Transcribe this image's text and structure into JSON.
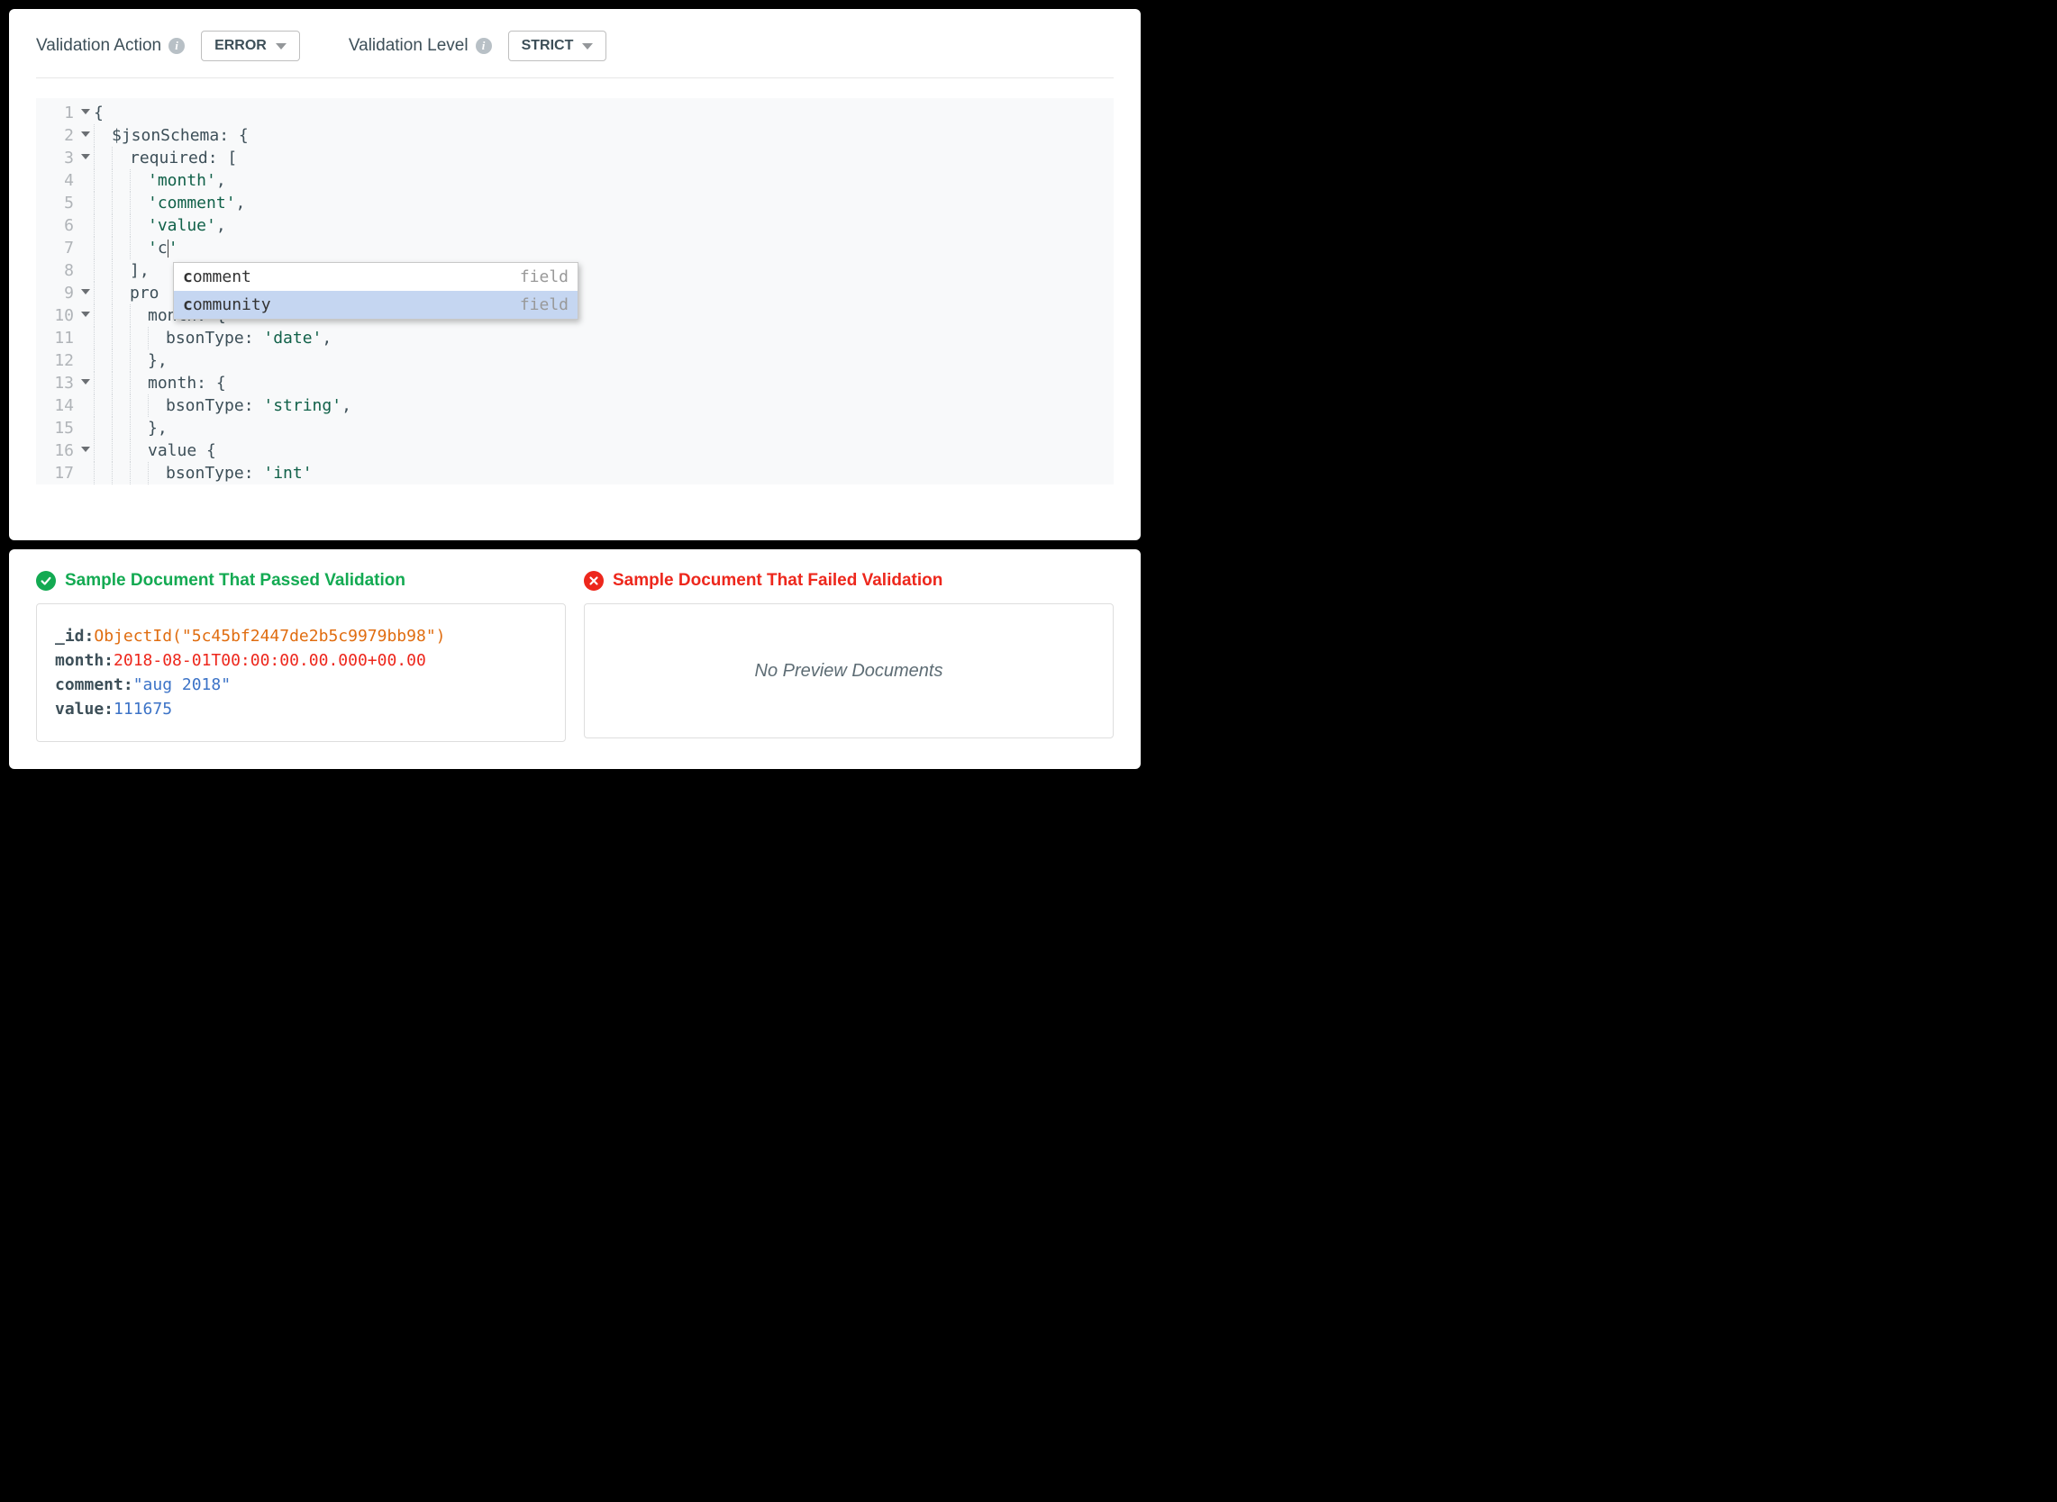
{
  "toolbar": {
    "action_label": "Validation Action",
    "action_value": "ERROR",
    "level_label": "Validation Level",
    "level_value": "STRICT"
  },
  "editor": {
    "lines": [
      "1",
      "2",
      "3",
      "4",
      "5",
      "6",
      "7",
      "8",
      "9",
      "10",
      "11",
      "12",
      "13",
      "14",
      "15",
      "16",
      "17"
    ],
    "fold_lines": [
      1,
      2,
      3,
      9,
      10,
      13,
      16
    ],
    "code": {
      "l1": "{",
      "l2": "$jsonSchema: {",
      "l3": "required: [",
      "l4q": "'month'",
      "l4t": ",",
      "l5q": "'comment'",
      "l5t": ",",
      "l6q": "'value'",
      "l6t": ",",
      "l7a": "'",
      "l7b": "c",
      "l7c": "'",
      "l8": "],",
      "l9": "pro",
      "l10": "month: {",
      "l11a": "bsonType: ",
      "l11b": "'date'",
      "l11c": ",",
      "l12": "},",
      "l13": "month: {",
      "l14a": "bsonType: ",
      "l14b": "'string'",
      "l14c": ",",
      "l15": "},",
      "l16": "value {",
      "l17a": "bsonType: ",
      "l17b": "'int'"
    }
  },
  "autocomplete": {
    "items": [
      {
        "prefix": "c",
        "rest": "omment",
        "hint": "field"
      },
      {
        "prefix": "c",
        "rest": "ommunity",
        "hint": "field"
      }
    ],
    "selected_index": 1
  },
  "results": {
    "pass_heading": "Sample Document That Passed Validation",
    "fail_heading": "Sample Document That Failed Validation",
    "fail_empty": "No Preview Documents",
    "passed_doc": {
      "id_key": "_id:",
      "id_val": "ObjectId(\"5c45bf2447de2b5c9979bb98\")",
      "month_key": "month:",
      "month_val": "2018-08-01T00:00:00.00.000+00.00",
      "comment_key": "comment:",
      "comment_val": "\"aug 2018\"",
      "value_key": "value:",
      "value_val": "111675"
    }
  }
}
